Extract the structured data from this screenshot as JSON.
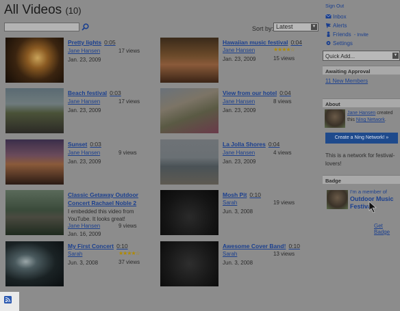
{
  "header": {
    "title": "All Videos",
    "count": "(10)",
    "sort_label": "Sort by:",
    "sort_value": "Latest"
  },
  "videos": [
    {
      "title": "Pretty lights",
      "duration": "0:05",
      "author": "Jane Hansen",
      "views": "17 views",
      "date": "Jan. 23, 2009"
    },
    {
      "title": "Hawaiian music festival",
      "duration": "0:04",
      "author": "Jane Hansen",
      "views": "15 views",
      "date": "Jan. 23, 2009",
      "rating": 4
    },
    {
      "title": "Beach festival",
      "duration": "0:03",
      "author": "Jane Hansen",
      "views": "17 views",
      "date": "Jan. 23, 2009"
    },
    {
      "title": "View from our hotel",
      "duration": "0:04",
      "author": "Jane Hansen",
      "views": "8 views",
      "date": "Jan. 23, 2009"
    },
    {
      "title": "Sunset",
      "duration": "0:03",
      "author": "Jane Hansen",
      "views": "9 views",
      "date": "Jan. 23, 2009"
    },
    {
      "title": "La Jolla Shores",
      "duration": "0:04",
      "author": "Jane Hansen",
      "views": "4 views",
      "date": "Jan. 23, 2009"
    },
    {
      "title": "Classic Getaway Outdoor",
      "title2": "Concert Rachael Noble 2",
      "description": "I embedded this video from YouTube. It looks great!",
      "author": "Jane Hansen",
      "views": "9 views",
      "date": "Jan. 16, 2009"
    },
    {
      "title": "Mosh Pit",
      "duration": "0:10",
      "author": "Sarah",
      "views": "19 views",
      "date": "Jun. 3, 2008"
    },
    {
      "title": "My First Concert",
      "duration": "0:10",
      "author": "Sarah",
      "views": "37 views",
      "date": "Jun. 3, 2008",
      "rating": 4
    },
    {
      "title": "Awesome Cover Band!",
      "duration": "0:10",
      "author": "Sarah",
      "views": "13 views",
      "date": "Jun. 3, 2008"
    }
  ],
  "sidebar": {
    "sign_out": "Sign Out",
    "inbox": "Inbox",
    "alerts": "Alerts",
    "friends": "Friends",
    "invite": "- Invite",
    "settings": "Settings",
    "quick_add": "Quick Add...",
    "awaiting_head": "Awaiting Approval",
    "new_members": "11 New Members",
    "about_head": "About",
    "about_user": "Jane Hansen",
    "about_created": "created this",
    "about_network": "Ning Network",
    "about_period": ".",
    "create_button": "Create a Ning Network! »",
    "description": "This is a network for festival-lovers!",
    "badge_head": "Badge",
    "badge_line1": "I'm a member of",
    "badge_line2": "Outdoor Music",
    "badge_line3": "Festival",
    "get_badge": "Get Badge"
  },
  "colors": {
    "link": "#1a3f8f",
    "background": "#8c8c8c",
    "button": "#1e4a8c",
    "stars": "#b08a00"
  }
}
